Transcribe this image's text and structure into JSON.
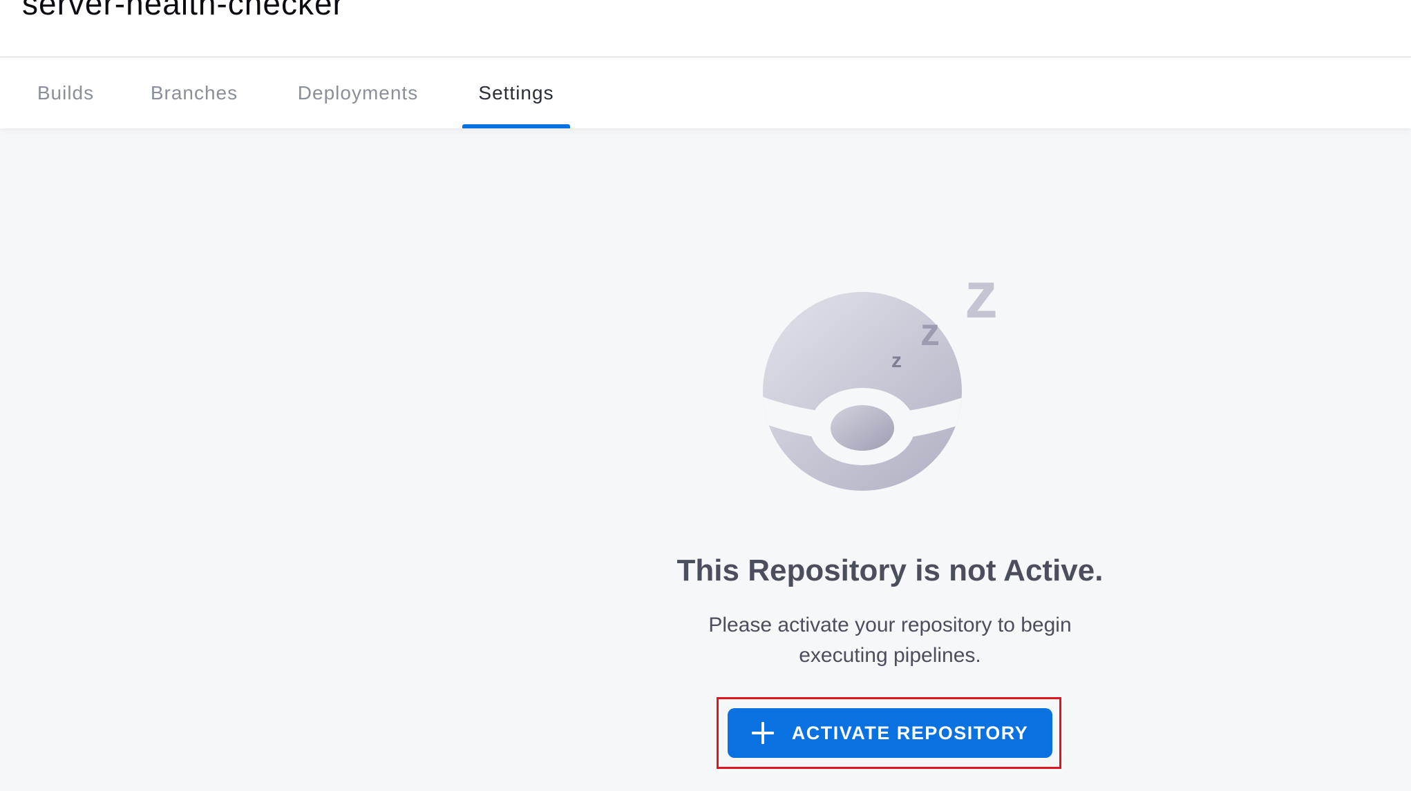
{
  "header": {
    "repo_name": "server-health-checker"
  },
  "tabs": [
    {
      "label": "Builds",
      "active": false
    },
    {
      "label": "Branches",
      "active": false
    },
    {
      "label": "Deployments",
      "active": false
    },
    {
      "label": "Settings",
      "active": true
    }
  ],
  "empty_state": {
    "illustration_icon": "sleeping-ball-icon",
    "title": "This Repository is not Active.",
    "description": "Please activate your repository to begin executing pipelines.",
    "button_label": "ACTIVATE REPOSITORY",
    "button_icon": "plus-icon"
  },
  "colors": {
    "accent": "#0a72e0",
    "highlight": "#e0141e",
    "text": "#4b4e5c",
    "background": "#f6f7f9"
  }
}
